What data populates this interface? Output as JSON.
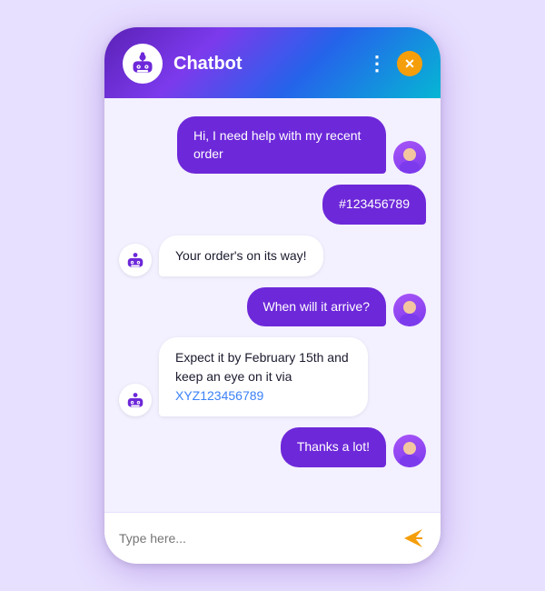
{
  "header": {
    "title": "Chatbot",
    "dots_label": "⋮",
    "close_label": "✕"
  },
  "messages": [
    {
      "id": 1,
      "sender": "user",
      "text": "Hi, I need help with my recent order"
    },
    {
      "id": 2,
      "sender": "user",
      "text": "#123456789"
    },
    {
      "id": 3,
      "sender": "bot",
      "text": "Your order's on its way!"
    },
    {
      "id": 4,
      "sender": "user",
      "text": "When will it arrive?"
    },
    {
      "id": 5,
      "sender": "bot",
      "text_before": "Expect it by February 15th and keep an eye on it via",
      "link_text": "XYZ123456789",
      "link_url": "#"
    },
    {
      "id": 6,
      "sender": "user",
      "text": "Thanks a lot!"
    }
  ],
  "input": {
    "placeholder": "Type here..."
  },
  "colors": {
    "user_bubble": "#6d28d9",
    "bot_bubble": "#ffffff",
    "header_gradient_start": "#5b21b6",
    "header_gradient_end": "#06b6d4",
    "accent": "#f59e0b"
  }
}
